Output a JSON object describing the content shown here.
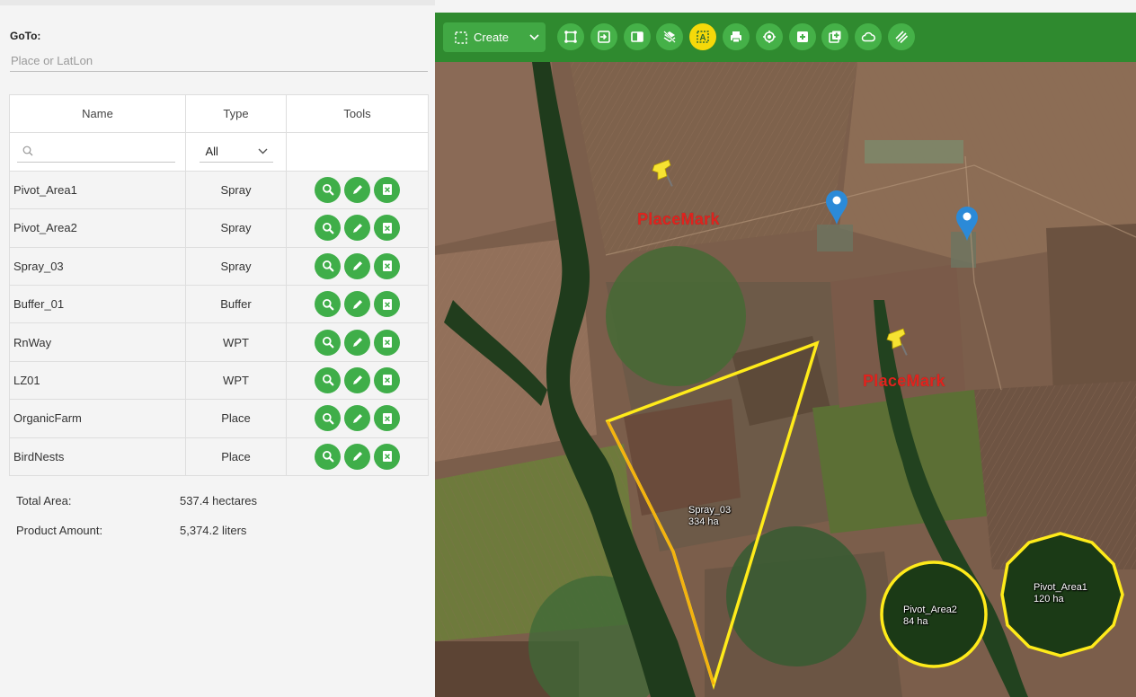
{
  "goto": {
    "label": "GoTo:",
    "placeholder": "Place or LatLon"
  },
  "table": {
    "headers": {
      "name": "Name",
      "type": "Type",
      "tools": "Tools"
    },
    "filter_type_value": "All",
    "rows": [
      {
        "name": "Pivot_Area1",
        "type": "Spray"
      },
      {
        "name": "Pivot_Area2",
        "type": "Spray"
      },
      {
        "name": "Spray_03",
        "type": "Spray"
      },
      {
        "name": "Buffer_01",
        "type": "Buffer"
      },
      {
        "name": "RnWay",
        "type": "WPT"
      },
      {
        "name": "LZ01",
        "type": "WPT"
      },
      {
        "name": "OrganicFarm",
        "type": "Place"
      },
      {
        "name": "BirdNests",
        "type": "Place"
      }
    ],
    "tool_icons": [
      "zoom-icon",
      "edit-icon",
      "delete-icon"
    ]
  },
  "summary": {
    "total_area_label": "Total Area:",
    "total_area_value": "537.4 hectares",
    "product_amount_label": "Product Amount:",
    "product_amount_value": "5,374.2 liters"
  },
  "toolbar": {
    "create_label": "Create",
    "icons": [
      "select-icon",
      "import-icon",
      "panel-icon",
      "layers-icon",
      "label-icon",
      "print-icon",
      "locate-icon",
      "add-icon",
      "add-layer-icon",
      "cloud-icon",
      "hatch-icon"
    ],
    "active_icon": "label-icon"
  },
  "map": {
    "placemark_1": "PlaceMark",
    "placemark_2": "PlaceMark",
    "spray_03_name": "Spray_03",
    "spray_03_area": "334 ha",
    "pivot_area2_name": "Pivot_Area2",
    "pivot_area2_area": "84 ha",
    "pivot_area1_name": "Pivot_Area1",
    "pivot_area1_area": "120 ha"
  },
  "colors": {
    "accent_green": "#3fae49",
    "toolbar_green": "#2f8a2f",
    "active_yellow": "#f5d90a",
    "polygon_yellow": "#ffeb1a",
    "placemark_red": "#e0231e",
    "marker_blue": "#2b8ad8"
  }
}
